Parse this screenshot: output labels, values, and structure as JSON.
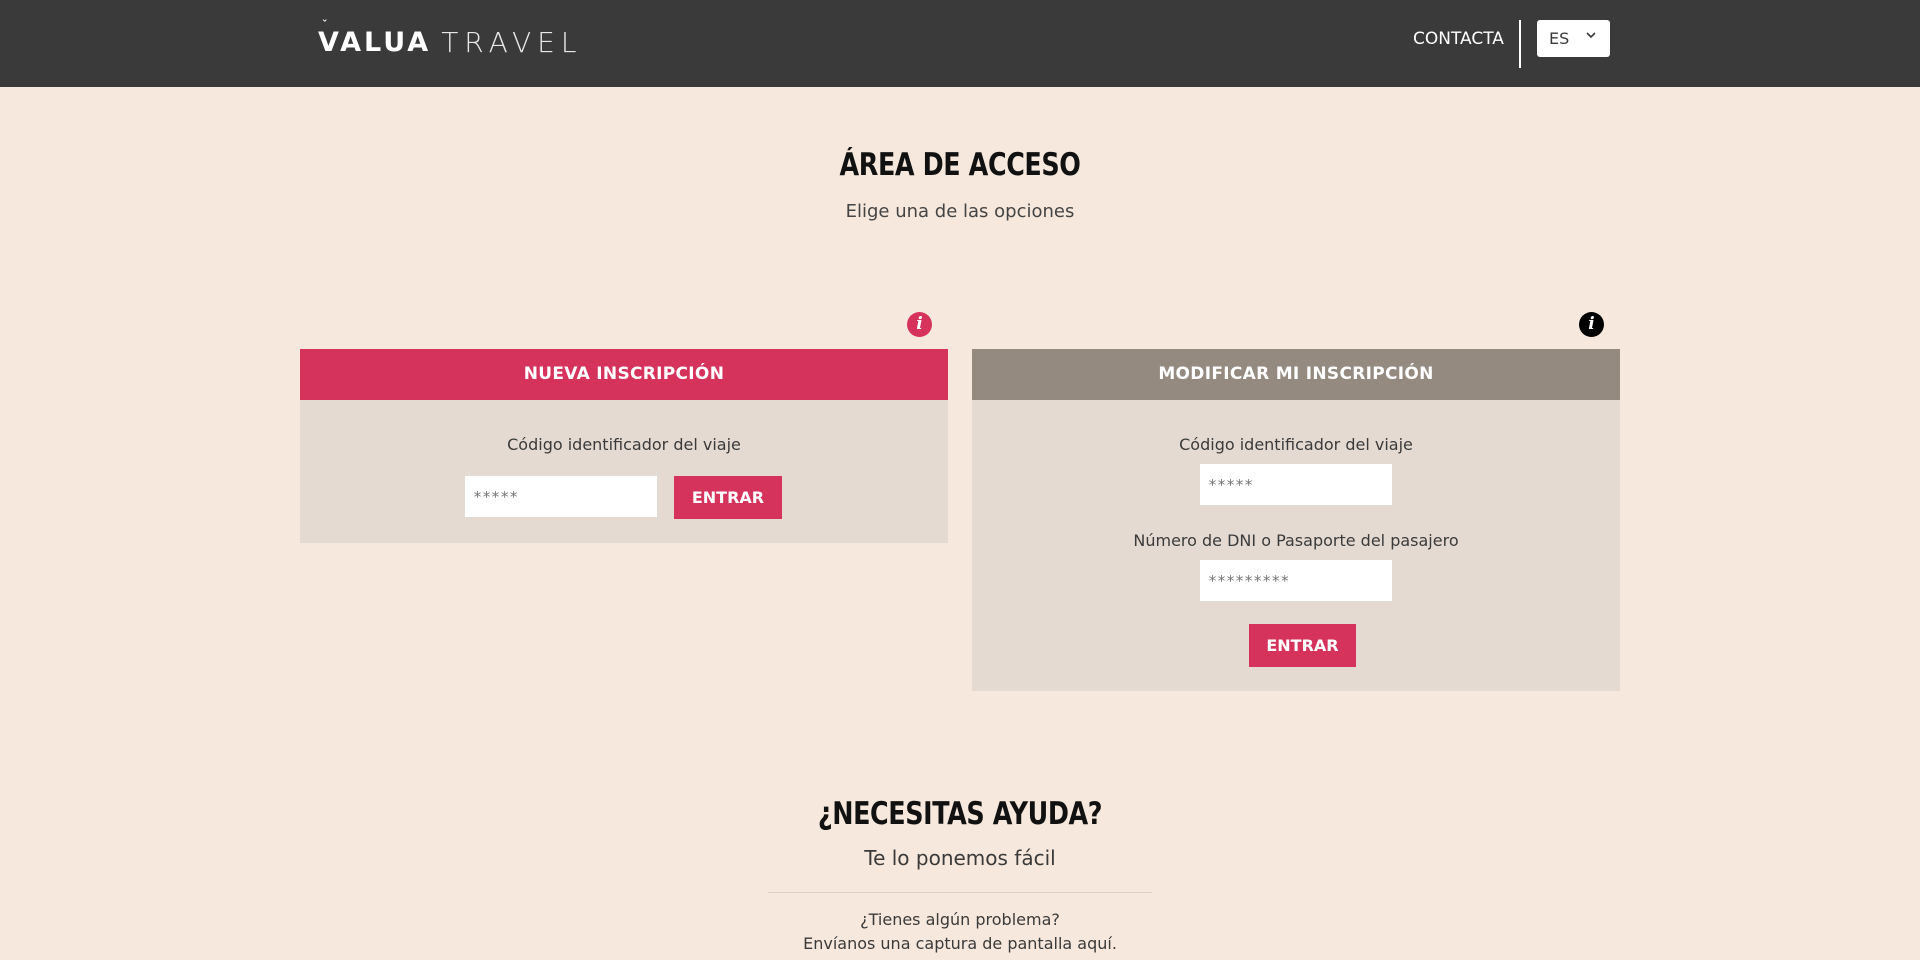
{
  "header": {
    "logo_main": "VALUA",
    "logo_sub": "TRAVEL",
    "contact_label": "CONTACTA",
    "language": "ES"
  },
  "main": {
    "title": "ÁREA DE ACCESO",
    "subtitle": "Elige una de las opciones"
  },
  "new_card": {
    "title": "NUEVA INSCRIPCIÓN",
    "trip_code_label": "Código identificador del viaje",
    "trip_code_placeholder": "*****",
    "button_label": "ENTRAR"
  },
  "modify_card": {
    "title": "MODIFICAR MI INSCRIPCIÓN",
    "trip_code_label": "Código identificador del viaje",
    "trip_code_placeholder": "*****",
    "id_label": "Número de DNI o Pasaporte del pasajero",
    "id_placeholder": "*********",
    "button_label": "ENTRAR"
  },
  "help": {
    "title": "¿NECESITAS AYUDA?",
    "subtitle": "Te lo ponemos fácil",
    "line1": "¿Tienes algún problema?",
    "line2": "Envíanos una captura de pantalla aquí."
  },
  "colors": {
    "accent": "#d6335c",
    "header_bg": "#3a3a3a",
    "page_bg": "#f6e8dc",
    "card_bg": "#e4dad2",
    "modify_header": "#958a80"
  },
  "icons": {
    "info_new": "info-icon",
    "info_modify": "info-icon",
    "language_dropdown": "chevron-down-icon"
  }
}
